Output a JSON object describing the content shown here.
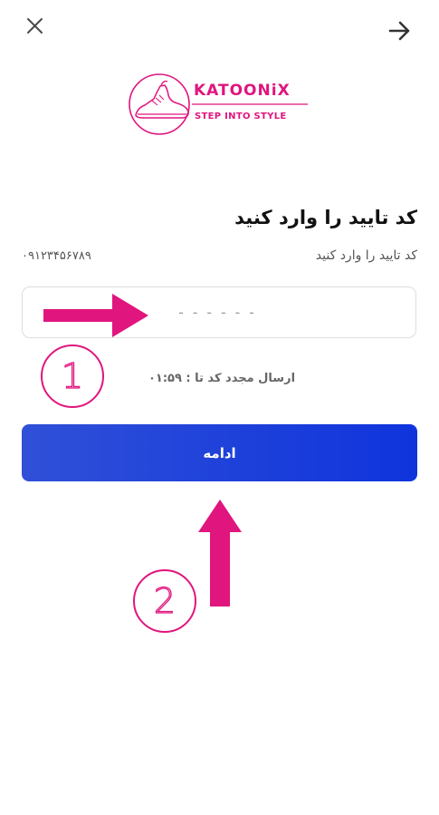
{
  "header": {
    "close_icon": "close-icon",
    "back_icon": "arrow-right-icon"
  },
  "brand": {
    "name": "KATOONiX",
    "slogan": "STEP INTO STYLE",
    "color": "#e0157e"
  },
  "verification": {
    "title": "کد تایید را وارد کنید",
    "subtitle": "کد تایید را وارد کنید",
    "phone": "۰۹۱۲۳۴۵۶۷۸۹",
    "code_placeholder": "------",
    "resend_text": "ارسال مجدد کد تا : ۰۱:۵۹"
  },
  "continue_button": {
    "label": "ادامه",
    "gradient_start": "#3050d8",
    "gradient_end": "#0f34dc"
  },
  "annotations": {
    "color": "#e0157e",
    "step_1": "1",
    "step_2": "2"
  }
}
